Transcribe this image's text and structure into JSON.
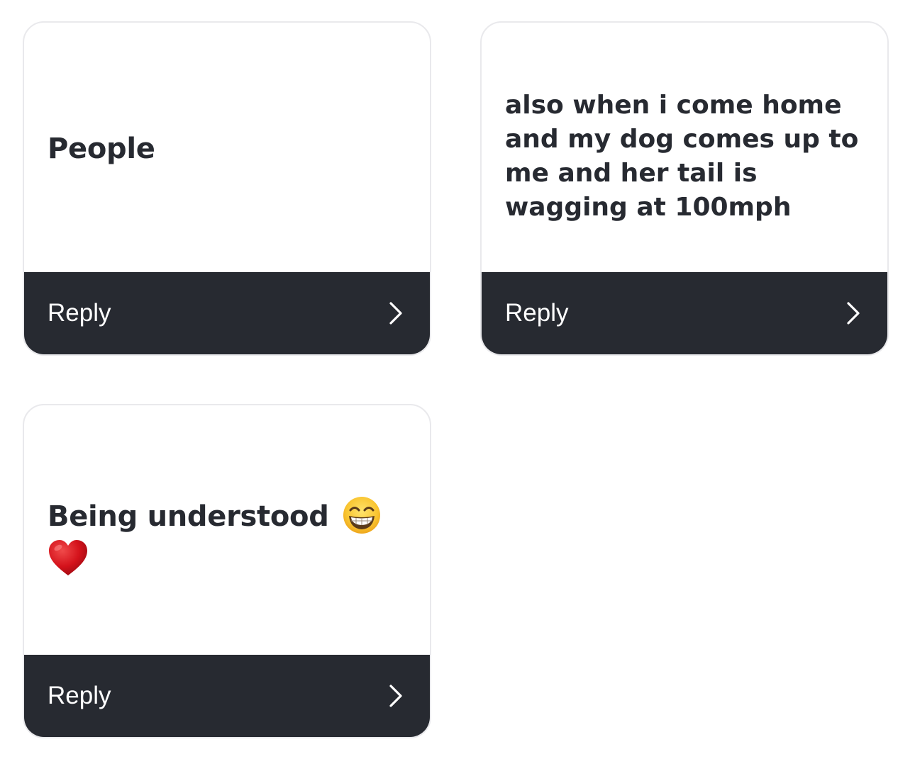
{
  "cards": [
    {
      "text": "People",
      "reply_label": "Reply"
    },
    {
      "text": "also when i come home and my dog comes up to me and her tail is wagging at 100mph",
      "reply_label": "Reply"
    },
    {
      "text": "Being understood",
      "emojis": [
        "beaming-face-with-smiling-eyes",
        "red-heart"
      ],
      "reply_label": "Reply"
    }
  ],
  "icons": {
    "chevron": "chevron-right-icon"
  },
  "colors": {
    "footer_background": "#272a31",
    "text": "#272a31",
    "reply_text": "#ffffff",
    "card_border": "#e9e9ec"
  }
}
